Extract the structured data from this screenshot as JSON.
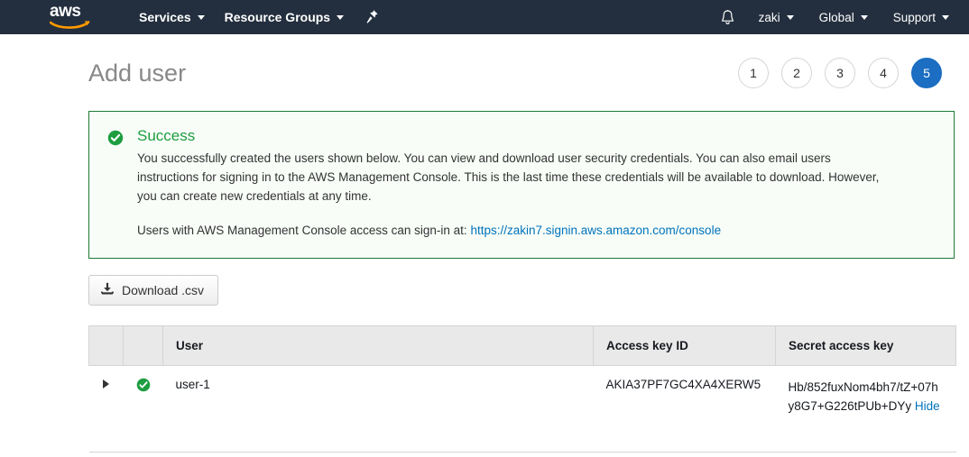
{
  "navbar": {
    "logo_text": "aws",
    "logo_icon": "aws-smile-logo",
    "items": [
      {
        "label": "Services",
        "icon": "chevron-down-icon"
      },
      {
        "label": "Resource Groups",
        "icon": "chevron-down-icon"
      }
    ],
    "pin_icon": "pushpin-icon",
    "bell_icon": "notifications-bell-icon",
    "right_items": [
      {
        "label": "zaki",
        "icon": "chevron-down-icon"
      },
      {
        "label": "Global",
        "icon": "chevron-down-icon"
      },
      {
        "label": "Support",
        "icon": "chevron-down-icon"
      }
    ]
  },
  "page": {
    "title": "Add user",
    "steps": [
      {
        "number": "1",
        "active": false
      },
      {
        "number": "2",
        "active": false
      },
      {
        "number": "3",
        "active": false
      },
      {
        "number": "4",
        "active": false
      },
      {
        "number": "5",
        "active": true
      }
    ]
  },
  "banner": {
    "icon": "success-check-circle-icon",
    "title": "Success",
    "body": "You successfully created the users shown below. You can view and download user security credentials. You can also email users instructions for signing in to the AWS Management Console. This is the last time these credentials will be available to download. However, you can create new credentials at any time.",
    "signin_prefix": "Users with AWS Management Console access can sign-in at:",
    "signin_url": "https://zakin7.signin.aws.amazon.com/console",
    "border_color": "#1e7b34",
    "background_color": "#f8fdf8",
    "title_color": "#1e9e40"
  },
  "toolbar": {
    "download_label": "Download .csv",
    "download_icon": "download-icon"
  },
  "table": {
    "headers": {
      "toggle": "",
      "status": "",
      "user": "User",
      "access_key_id": "Access key ID",
      "secret_access_key": "Secret access key"
    },
    "rows": [
      {
        "toggle_icon": "expand-triangle-icon",
        "status_icon": "success-check-circle-icon",
        "user": "user-1",
        "access_key_id": "AKIA37PF7GC4XA4XERW5",
        "secret_access_key": "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",
        "hide_label": "Hide"
      }
    ]
  },
  "colors": {
    "nav_background": "#232f3e",
    "accent_blue": "#1b6ec2",
    "link_blue": "#0073bb",
    "success_green": "#1e9e40"
  }
}
